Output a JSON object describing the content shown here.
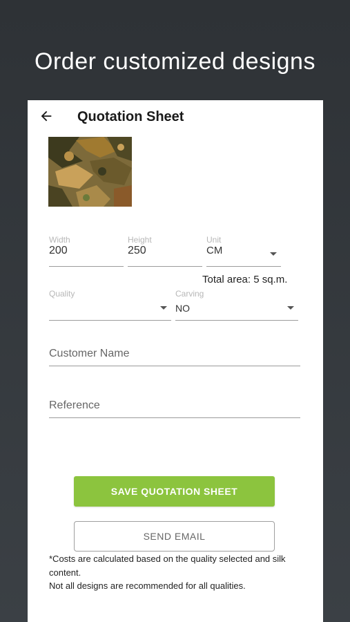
{
  "promo": {
    "title": "Order customized designs"
  },
  "appbar": {
    "title": "Quotation Sheet",
    "back_icon": "arrow-left-icon"
  },
  "design": {
    "image_alt": "camouflage rug design",
    "colors": [
      "#6b5a2c",
      "#a07a30",
      "#3d3a1e",
      "#c9a15a",
      "#7d6a3a"
    ]
  },
  "form": {
    "width": {
      "label": "Width",
      "value": "200"
    },
    "height": {
      "label": "Height",
      "value": "250"
    },
    "unit": {
      "label": "Unit",
      "value": "CM"
    },
    "total_area": "Total area: 5 sq.m.",
    "quality": {
      "label": "Quality",
      "value": ""
    },
    "carving": {
      "label": "Carving",
      "value": "NO"
    },
    "customer_name": {
      "placeholder": "Customer Name"
    },
    "reference": {
      "placeholder": "Reference"
    }
  },
  "buttons": {
    "save": "SAVE QUOTATION SHEET",
    "email": "SEND EMAIL"
  },
  "notes": [
    "*Costs are calculated based on the quality selected and silk content.",
    "Not all designs are recommended for all qualities."
  ],
  "colors": {
    "accent": "#8cc43e",
    "background": "#2e3236"
  }
}
